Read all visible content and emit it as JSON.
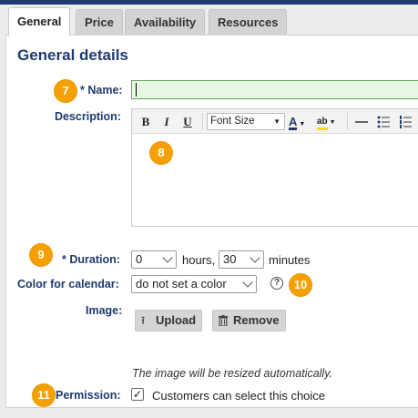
{
  "tabs": [
    {
      "label": "General",
      "active": true
    },
    {
      "label": "Price",
      "active": false
    },
    {
      "label": "Availability",
      "active": false
    },
    {
      "label": "Resources",
      "active": false
    }
  ],
  "section_title": "General details",
  "badges": {
    "name": "7",
    "description": "8",
    "duration": "9",
    "color": "10",
    "permission": "11"
  },
  "name_field": {
    "required_mark": "*",
    "label": "Name:",
    "value": ""
  },
  "description": {
    "label": "Description:",
    "toolbar": {
      "bold": "B",
      "italic": "I",
      "underline": "U",
      "font_size": "Font Size",
      "font_color": "A",
      "highlight": "ab"
    }
  },
  "duration": {
    "required_mark": "*",
    "label": "Duration:",
    "hours_value": "0",
    "hours_unit": "hours,",
    "minutes_value": "30",
    "minutes_unit": "minutes"
  },
  "color": {
    "label": "Color for calendar:",
    "value": "do not set a color",
    "help": "?"
  },
  "image": {
    "label": "Image:",
    "upload_label": "Upload",
    "remove_label": "Remove",
    "note": "The image will be resized automatically."
  },
  "permission": {
    "label": "Permission:",
    "checked": true,
    "check_mark": "✓",
    "text": "Customers can select this choice"
  },
  "colors": {
    "accent": "#1f3b6f",
    "badge": "#f5a000",
    "name_input_bg": "#e6f8e4"
  }
}
